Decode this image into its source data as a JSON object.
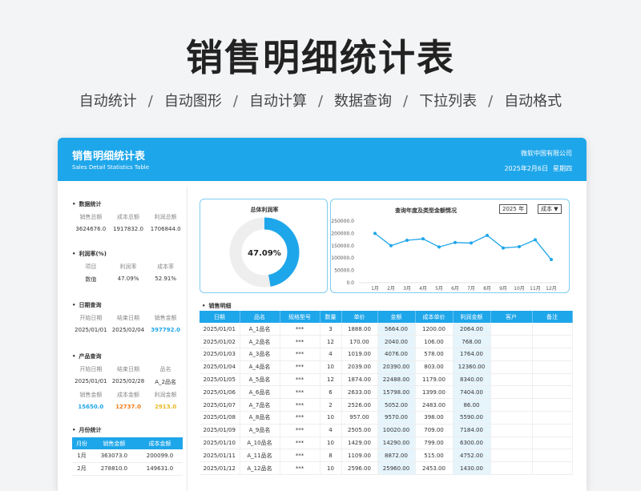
{
  "hero": {
    "title": "销售明细统计表",
    "features": [
      "自动统计",
      "自动图形",
      "自动计算",
      "数据查询",
      "下拉列表",
      "自动格式"
    ]
  },
  "header": {
    "title": "销售明细统计表",
    "subtitle": "Sales Detail Statistics Table",
    "company": "微软中国有限公司",
    "date": "2025年2月6日",
    "weekday": "星期四"
  },
  "stats": {
    "title": "数据统计",
    "labels": [
      "销售总额",
      "成本总额",
      "利润总额"
    ],
    "values": [
      "3624676.0",
      "1917832.0",
      "1706844.0"
    ]
  },
  "profit_rate": {
    "title": "利润率(%)",
    "labels": [
      "项目",
      "利润率",
      "成本率"
    ],
    "values": [
      "数值",
      "47.09%",
      "52.91%"
    ]
  },
  "date_query": {
    "title": "日期查询",
    "labels": [
      "开始日期",
      "结束日期",
      "销售金额"
    ],
    "values": [
      "2025/01/01",
      "2025/02/04",
      "397792.0"
    ]
  },
  "product_query": {
    "title": "产品查询",
    "labels": [
      "开始日期",
      "结束日期",
      "品名"
    ],
    "values": [
      "2025/01/01",
      "2025/02/28",
      "A_2品名"
    ],
    "labels2": [
      "销售金额",
      "成本金额",
      "利润金额"
    ],
    "values2": [
      "15650.0",
      "12737.0",
      "2913.0"
    ]
  },
  "monthly": {
    "title": "月份统计",
    "headers": [
      "月份",
      "销售金额",
      "成本金额"
    ],
    "rows": [
      [
        "1月",
        "363073.0",
        "200099.0"
      ],
      [
        "2月",
        "278810.0",
        "149631.0"
      ]
    ]
  },
  "donut": {
    "title": "总体利润率",
    "value": 47.09,
    "label": "47.09%",
    "colors": {
      "fill": "#1ea6ea",
      "track": "#eeeeee"
    }
  },
  "line_panel": {
    "title": "查询年度及类型金额情况",
    "year": "2025",
    "year_unit": "年",
    "type": "成本"
  },
  "chart_data": {
    "type": "line",
    "title": "查询年度及类型金额情况",
    "categories": [
      "1月",
      "2月",
      "3月",
      "4月",
      "5月",
      "6月",
      "7月",
      "8月",
      "9月",
      "10月",
      "11月",
      "12月"
    ],
    "series": [
      {
        "values": [
          200099,
          150000,
          172000,
          178000,
          145000,
          163000,
          161000,
          192000,
          141000,
          146000,
          174000,
          94000
        ]
      }
    ],
    "yticks": [
      "250000.0",
      "200000.0",
      "150000.0",
      "100000.0",
      "50000.0",
      "0.0"
    ],
    "ylim": [
      0,
      250000
    ],
    "color": "#1ea6ea"
  },
  "detail": {
    "title": "销售明细",
    "headers": [
      "日期",
      "品名",
      "规格型号",
      "数量",
      "单价",
      "金额",
      "成本单价",
      "利润金额",
      "客户",
      "备注"
    ],
    "rows": [
      [
        "2025/01/01",
        "A_1品名",
        "***",
        "3",
        "1888.00",
        "5664.00",
        "1200.00",
        "2064.00",
        "",
        ""
      ],
      [
        "2025/01/02",
        "A_2品名",
        "***",
        "12",
        "170.00",
        "2040.00",
        "106.00",
        "768.00",
        "",
        ""
      ],
      [
        "2025/01/03",
        "A_3品名",
        "***",
        "4",
        "1019.00",
        "4076.00",
        "578.00",
        "1764.00",
        "",
        ""
      ],
      [
        "2025/01/04",
        "A_4品名",
        "***",
        "10",
        "2039.00",
        "20390.00",
        "803.00",
        "12360.00",
        "",
        ""
      ],
      [
        "2025/01/05",
        "A_5品名",
        "***",
        "12",
        "1874.00",
        "22488.00",
        "1179.00",
        "8340.00",
        "",
        ""
      ],
      [
        "2025/01/06",
        "A_6品名",
        "***",
        "6",
        "2633.00",
        "15798.00",
        "1399.00",
        "7404.00",
        "",
        ""
      ],
      [
        "2025/01/07",
        "A_7品名",
        "***",
        "2",
        "2526.00",
        "5052.00",
        "2483.00",
        "86.00",
        "",
        ""
      ],
      [
        "2025/01/08",
        "A_8品名",
        "***",
        "10",
        "957.00",
        "9570.00",
        "398.00",
        "5590.00",
        "",
        ""
      ],
      [
        "2025/01/09",
        "A_9品名",
        "***",
        "4",
        "2505.00",
        "10020.00",
        "709.00",
        "7184.00",
        "",
        ""
      ],
      [
        "2025/01/10",
        "A_10品名",
        "***",
        "10",
        "1429.00",
        "14290.00",
        "799.00",
        "6300.00",
        "",
        ""
      ],
      [
        "2025/01/11",
        "A_11品名",
        "***",
        "8",
        "1109.00",
        "8872.00",
        "515.00",
        "4752.00",
        "",
        ""
      ],
      [
        "2025/01/12",
        "A_12品名",
        "***",
        "10",
        "2596.00",
        "25960.00",
        "2453.00",
        "1430.00",
        "",
        ""
      ]
    ]
  }
}
